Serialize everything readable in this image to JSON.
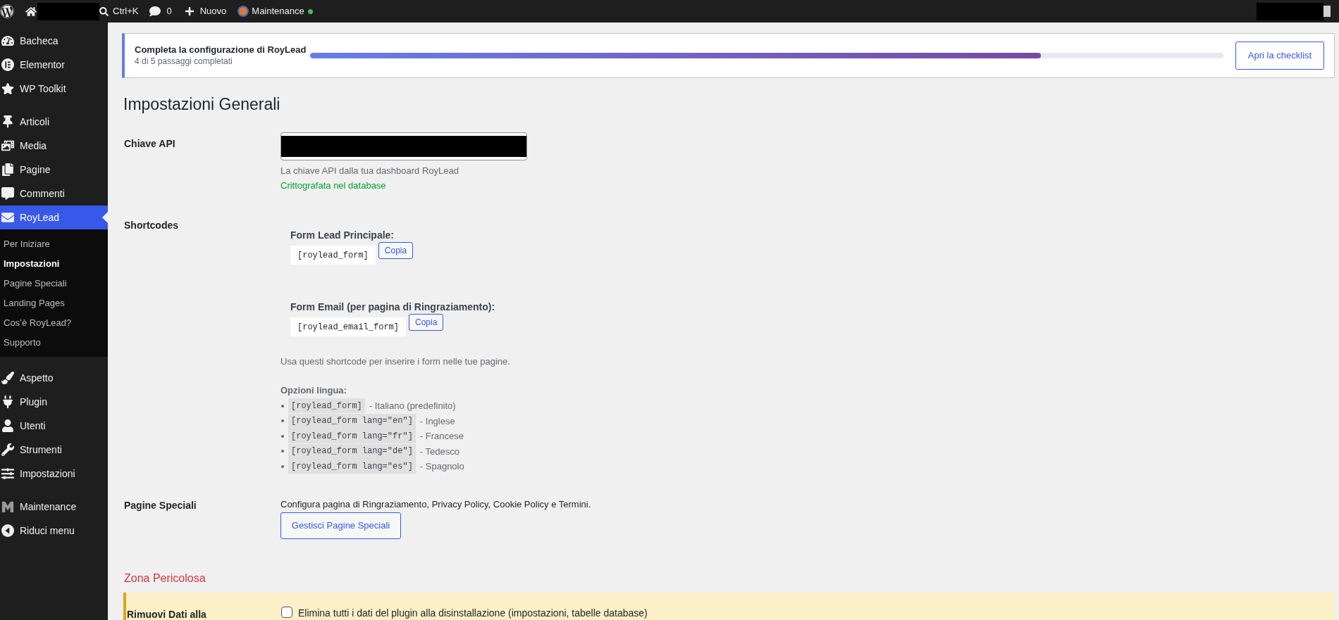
{
  "top_bar": {
    "search_shortcut": "Ctrl+K",
    "comments_count": "0",
    "new_label": "Nuovo",
    "site_status": "Maintenance"
  },
  "sidebar": {
    "groups": [
      {
        "items": [
          {
            "label": "Bacheca",
            "selected": false
          },
          {
            "label": "Elementor",
            "selected": false
          },
          {
            "label": "WP Toolkit",
            "selected": false
          }
        ]
      },
      {
        "items": [
          {
            "label": "Articoli",
            "selected": false
          },
          {
            "label": "Media",
            "selected": false
          },
          {
            "label": "Pagine",
            "selected": false
          },
          {
            "label": "Commenti",
            "selected": false
          },
          {
            "label": "RoyLead",
            "selected": true,
            "submenu": [
              {
                "label": "Per Iniziare",
                "selected": false
              },
              {
                "label": "Impostazioni",
                "selected": true
              },
              {
                "label": "Pagine Speciali",
                "selected": false
              },
              {
                "label": "Landing Pages",
                "selected": false
              },
              {
                "label": "Cos’è RoyLead?",
                "selected": false
              },
              {
                "label": "Supporto",
                "selected": false
              }
            ]
          }
        ]
      },
      {
        "items": [
          {
            "label": "Aspetto",
            "selected": false
          },
          {
            "label": "Plugin",
            "selected": false
          },
          {
            "label": "Utenti",
            "selected": false
          },
          {
            "label": "Strumenti",
            "selected": false
          },
          {
            "label": "Impostazioni",
            "selected": false
          }
        ]
      },
      {
        "items": [
          {
            "label": "Maintenance",
            "selected": false
          }
        ]
      }
    ],
    "collapse_label": "Riduci menu"
  },
  "setup_banner": {
    "title": "Completa la configurazione di RoyLead",
    "subtitle": "4 di 5 passaggi completati",
    "level": 0.8,
    "button": "Apri la checklist"
  },
  "page_title": "Impostazioni Generali",
  "api_key": {
    "label": "Chiave API",
    "description": "La chiave API dalla tua dashboard RoyLead",
    "status": "Crittografata nel database"
  },
  "shortcodes": {
    "label": "Shortcodes",
    "forms": [
      {
        "label": "Form Lead Principale:",
        "code": "[roylead_form]",
        "button": "Copia"
      },
      {
        "label": "Form Email (per pagina di Ringraziamento):",
        "code": "[roylead_email_form]",
        "button": "Copia"
      }
    ],
    "note": "Usa questi shortcode per inserire i form nelle tue pagine.",
    "languages_title": "Opzioni lingua:",
    "languages": [
      {
        "code": "[roylead_form]",
        "description": "- Italiano (predefinito)"
      },
      {
        "code": "[roylead_form lang=\"en\"]",
        "description": "- Inglese"
      },
      {
        "code": "[roylead_form lang=\"fr\"]",
        "description": "- Francese"
      },
      {
        "code": "[roylead_form lang=\"de\"]",
        "description": "- Tedesco"
      },
      {
        "code": "[roylead_form lang=\"es\"]",
        "description": "- Spagnolo"
      }
    ]
  },
  "special_pages": {
    "label": "Pagine Speciali",
    "description": "Configura pagina di Ringraziamento, Privacy Policy, Cookie Policy e Termini.",
    "button": "Gestisci Pagine Speciali"
  },
  "danger_zone": {
    "title": "Zona Pericolosa",
    "rows": [
      {
        "label": "Rimuovi Dati alla",
        "checkbox_label": "Elimina tutti i dati del plugin alla disinstallazione (impostazioni, tabelle database)",
        "checked": false
      }
    ]
  }
}
